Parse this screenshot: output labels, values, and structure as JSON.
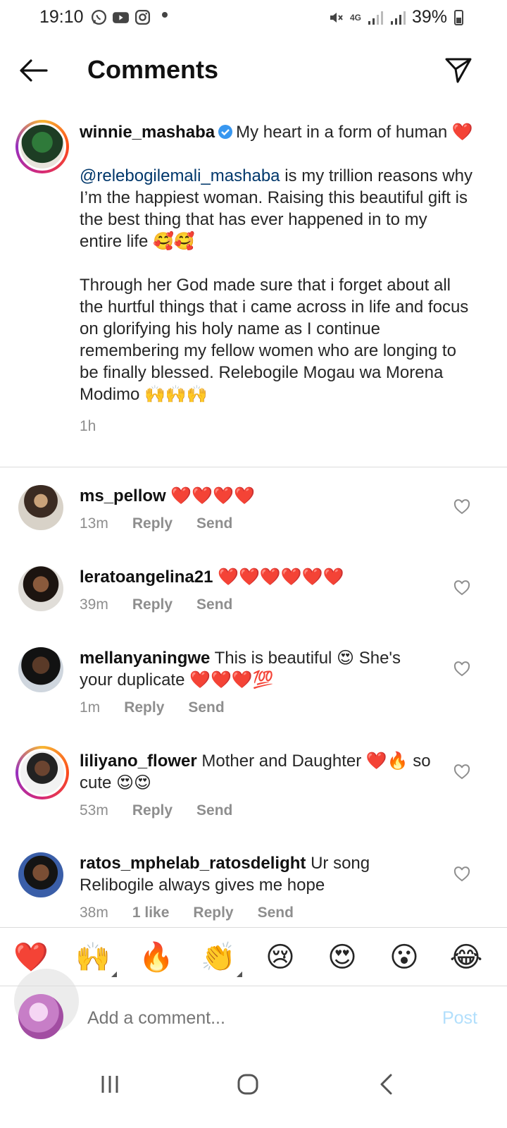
{
  "status_bar": {
    "time": "19:10",
    "battery": "39%",
    "network": "4G"
  },
  "header": {
    "title": "Comments"
  },
  "caption": {
    "username": "winnie_mashaba",
    "line1": "My heart in a form of human ❤️",
    "mention": "@relebogilemali_mashaba",
    "para1": " is my trillion reasons why I’m the happiest woman. Raising this beautiful gift is the best thing that has ever happened in to my entire life 🥰🥰",
    "para2": "Through her God made sure that i forget about all the hurtful things that i came across in life and focus on glorifying his holy name as I continue remembering my fellow women who are longing to be finally blessed. Relebogile Mogau wa Morena Modimo 🙌🙌🙌",
    "time": "1h"
  },
  "comments": [
    {
      "username": "ms_pellow",
      "text": "❤️❤️❤️❤️",
      "time": "13m",
      "likes": "",
      "reply": "Reply",
      "send": "Send"
    },
    {
      "username": "leratoangelina21",
      "text": "❤️❤️❤️❤️❤️❤️",
      "time": "39m",
      "likes": "",
      "reply": "Reply",
      "send": "Send"
    },
    {
      "username": "mellanyaningwe",
      "text": "This is beautiful 😍 She's your duplicate ❤️❤️❤️💯",
      "time": "1m",
      "likes": "",
      "reply": "Reply",
      "send": "Send"
    },
    {
      "username": "liliyano_flower",
      "text": "Mother and Daughter ❤️🔥 so cute 😍😍",
      "time": "53m",
      "likes": "",
      "reply": "Reply",
      "send": "Send"
    },
    {
      "username": "ratos_mphelab_ratosdelight",
      "text": "Ur song Relibogile always gives me hope",
      "time": "38m",
      "likes": "1 like",
      "reply": "Reply",
      "send": "Send"
    }
  ],
  "emoji_bar": [
    "❤️",
    "🙌",
    "🔥",
    "👏",
    "😢",
    "😍",
    "😮",
    "😂"
  ],
  "composer": {
    "placeholder": "Add a comment...",
    "post_label": "Post"
  }
}
